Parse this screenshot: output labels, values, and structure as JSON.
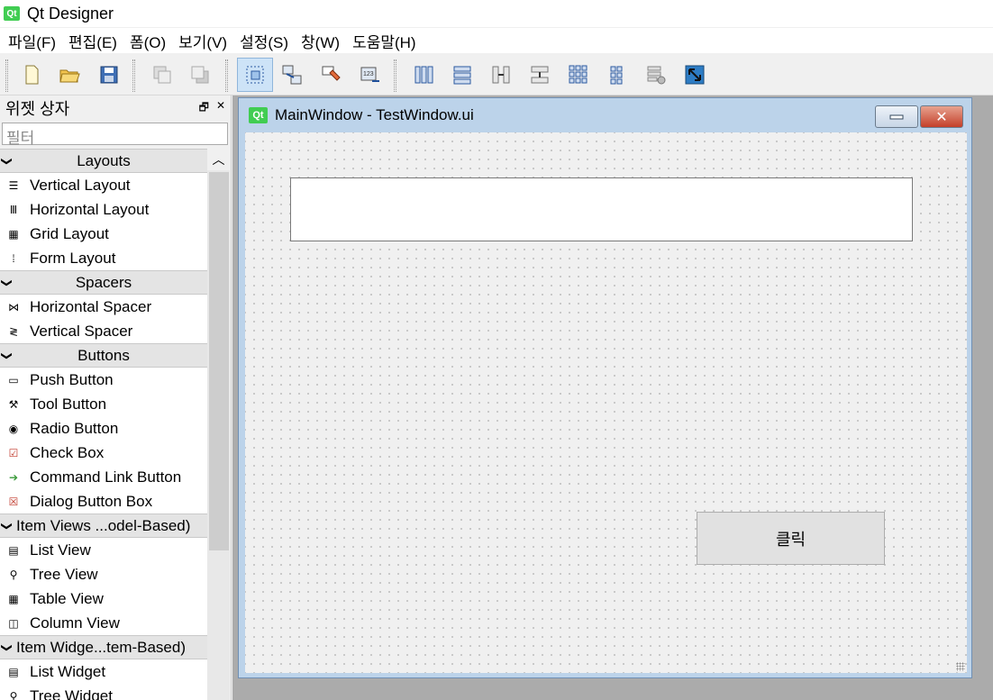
{
  "app": {
    "title": "Qt Designer",
    "logo_text": "Qt"
  },
  "menu": [
    "파일(F)",
    "편집(E)",
    "폼(O)",
    "보기(V)",
    "설정(S)",
    "창(W)",
    "도움말(H)"
  ],
  "toolbar": {
    "icons": [
      "new-file-icon",
      "open-folder-icon",
      "save-icon",
      "send-to-back-icon",
      "bring-to-front-icon",
      "edit-widgets-icon",
      "edit-signals-slots-icon",
      "edit-buddies-icon",
      "edit-tab-order-icon",
      "layout-horizontal-icon",
      "layout-vertical-icon",
      "layout-horizontal-splitter-icon",
      "layout-vertical-splitter-icon",
      "layout-grid-icon",
      "layout-form-icon",
      "break-layout-icon",
      "adjust-size-icon"
    ]
  },
  "widget_box": {
    "title": "위젯 상자",
    "filter_placeholder": "필터",
    "categories": [
      {
        "label": "Layouts",
        "items": [
          "Vertical Layout",
          "Horizontal Layout",
          "Grid Layout",
          "Form Layout"
        ]
      },
      {
        "label": "Spacers",
        "items": [
          "Horizontal Spacer",
          "Vertical Spacer"
        ]
      },
      {
        "label": "Buttons",
        "items": [
          "Push Button",
          "Tool Button",
          "Radio Button",
          "Check Box",
          "Command Link Button",
          "Dialog Button Box"
        ]
      },
      {
        "label": "Item Views ...odel-Based)",
        "items": [
          "List View",
          "Tree View",
          "Table View",
          "Column View"
        ]
      },
      {
        "label": "Item Widge...tem-Based)",
        "items": [
          "List Widget",
          "Tree Widget"
        ]
      }
    ]
  },
  "form": {
    "title": "MainWindow - TestWindow.ui",
    "logo_text": "Qt",
    "button_label": "클릭"
  }
}
